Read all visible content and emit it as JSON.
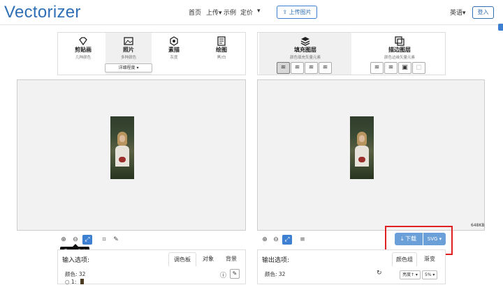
{
  "header": {
    "logo": "Vectorizer",
    "nav": [
      "首页",
      "上传▾",
      "示例",
      "定价",
      "▾"
    ],
    "upload_button": "上传图片",
    "language": "英语▾",
    "login": "登入"
  },
  "left_panel": {
    "modes": [
      {
        "title": "剪贴画",
        "sub": "几种颜色"
      },
      {
        "title": "照片",
        "sub": "多种颜色"
      },
      {
        "title": "素描",
        "sub": "灰度"
      },
      {
        "title": "绘图",
        "sub": "黑/白"
      }
    ],
    "detail_dropdown": "详细程度 ▾"
  },
  "right_panel": {
    "modes": [
      {
        "title": "填充图层",
        "sub": "颜色填充矢量元素"
      },
      {
        "title": "描边图层",
        "sub": "颜色边缘矢量元素"
      }
    ]
  },
  "output": {
    "file_size": "648KB",
    "download_label": "下载",
    "format_label": "SVG ▾"
  },
  "tooltip": "Zoom Out",
  "input_options": {
    "heading": "输入选项:",
    "tabs": [
      "调色板",
      "对象",
      "背景"
    ],
    "colors_label": "颜色: 32",
    "row1": "○ 1:"
  },
  "output_options": {
    "heading": "输出选项:",
    "tabs": [
      "颜色组",
      "渐变"
    ],
    "colors_label": "颜色: 32",
    "brightness": "亮度↑ ▾",
    "percent": "5% ▾"
  }
}
